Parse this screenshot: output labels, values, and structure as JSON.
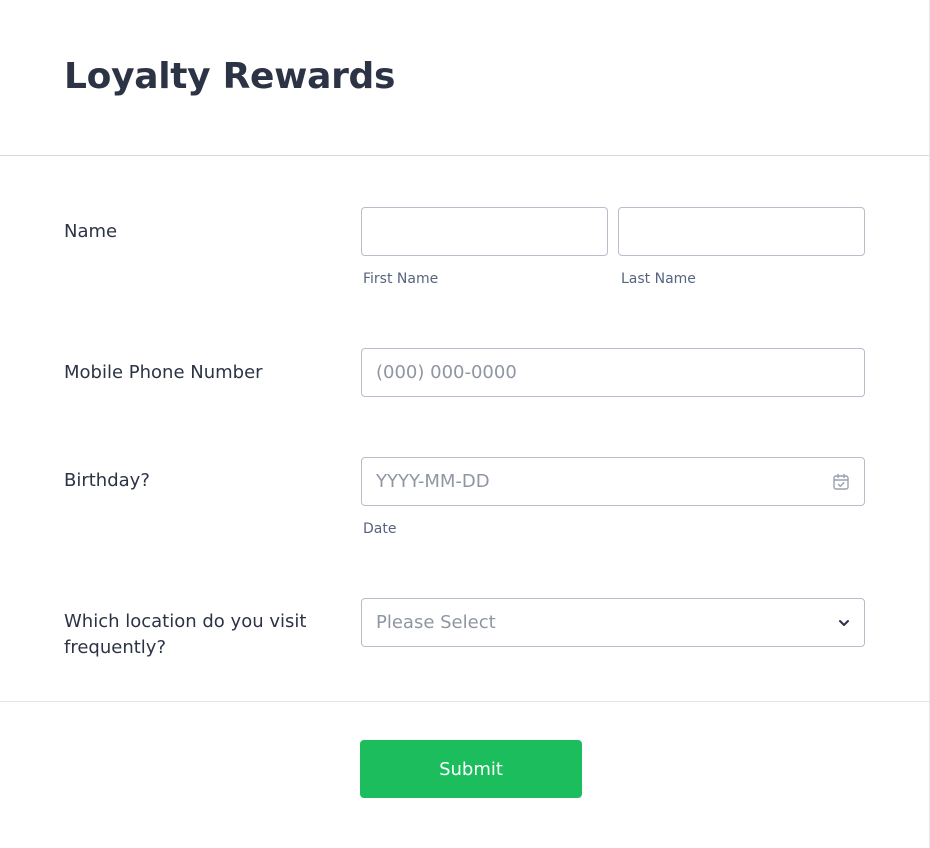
{
  "form": {
    "title": "Loyalty Rewards",
    "fields": {
      "name": {
        "label": "Name",
        "first_name_value": "",
        "last_name_value": "",
        "first_name_sublabel": "First Name",
        "last_name_sublabel": "Last Name"
      },
      "phone": {
        "label": "Mobile Phone Number",
        "placeholder": "(000) 000-0000",
        "value": ""
      },
      "birthday": {
        "label": "Birthday?",
        "placeholder": "YYYY-MM-DD",
        "sublabel": "Date",
        "icon": "calendar-icon"
      },
      "location": {
        "label": "Which location do you visit frequently?",
        "selected_text": "Please Select",
        "icon": "chevron-down-icon"
      }
    },
    "submit_label": "Submit"
  },
  "colors": {
    "text": "#2c3345",
    "sublabel": "#57647e",
    "placeholder": "#8f96a3",
    "border": "#b8bdc9",
    "submit": "#1bbd5d"
  }
}
